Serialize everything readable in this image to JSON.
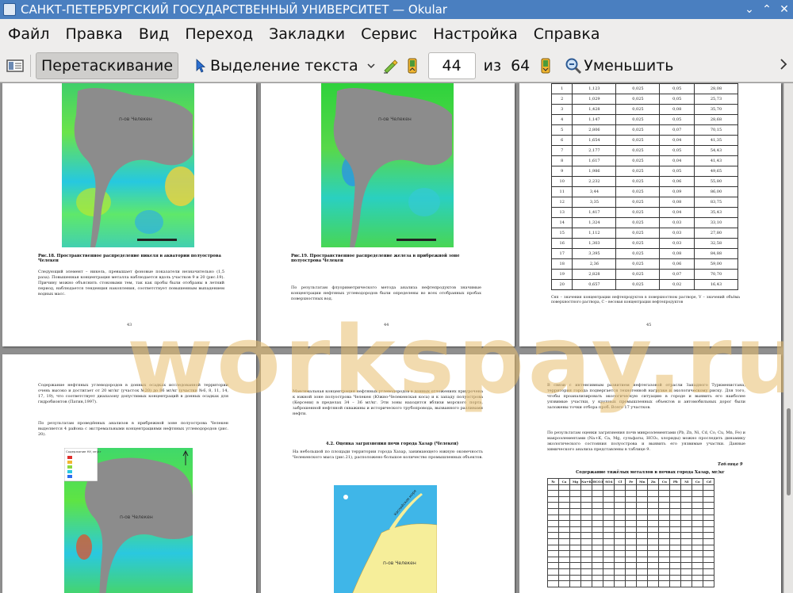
{
  "window": {
    "title": "САНКТ-ПЕТЕРБУРГСКИЙ ГОСУДАРСТВЕННЫЙ УНИВЕРСИТЕТ  — Okular",
    "btn_min": "⌄",
    "btn_max": "⌃",
    "btn_close": "✕"
  },
  "menu": [
    "Файл",
    "Правка",
    "Вид",
    "Переход",
    "Закладки",
    "Сервис",
    "Настройка",
    "Справка"
  ],
  "toolbar": {
    "browse": "Перетаскивание",
    "select_text": "Выделение текста",
    "page_current": "44",
    "page_of": "из",
    "page_total": "64",
    "zoom_out": "Уменьшить"
  },
  "watermark": "workspay.ru",
  "pages": {
    "p43": {
      "map_label": "п-ов Челекен",
      "caption": "Рис.18. Пространственное распределение никеля в акватории полуострова Челекен",
      "text": "Следующий элемент – никель, превышает фоновые показатели незначительно (1,5 раза). Повышенная концентрация металла наблюдается вдоль участков 9 и 20 (рис.19). Причину можно объяснить стоковыми тем, так как пробы были отобраны в летний период, наблюдается тенденция накопления, соответствует повышенным выпадением водных масс.",
      "num": "43"
    },
    "p44": {
      "map_label": "п-ов Челекен",
      "caption": "Рис.19. Пространственное распределение железа в прибрежной зоне полуострова Челекен",
      "text": "По результатам флуориметрического метода анализа нефтепродуктов значимые концентрации нефтяных углеводородов были определены во всех отобранных пробах поверхностных вод.",
      "num": "44"
    },
    "p45": {
      "rows": [
        [
          "1",
          "1,123",
          "0,025",
          "0,05",
          "28,08"
        ],
        [
          "2",
          "1,029",
          "0,025",
          "0,05",
          "25,73"
        ],
        [
          "3",
          "1,428",
          "0,025",
          "0,08",
          "35,70"
        ],
        [
          "4",
          "1,147",
          "0,025",
          "0,05",
          "28,68"
        ],
        [
          "5",
          "2,806",
          "0,025",
          "0,07",
          "70,15"
        ],
        [
          "6",
          "1,654",
          "0,025",
          "0,04",
          "41,35"
        ],
        [
          "7",
          "2,177",
          "0,025",
          "0,05",
          "54,43"
        ],
        [
          "8",
          "1,617",
          "0,025",
          "0,04",
          "41,43"
        ],
        [
          "9",
          "1,986",
          "0,025",
          "0,05",
          "49,65"
        ],
        [
          "10",
          "2,232",
          "0,025",
          "0,06",
          "55,80"
        ],
        [
          "11",
          "3,44",
          "0,025",
          "0,09",
          "86,00"
        ],
        [
          "12",
          "3,35",
          "0,025",
          "0,08",
          "83,75"
        ],
        [
          "13",
          "1,417",
          "0,025",
          "0,04",
          "35,43"
        ],
        [
          "14",
          "1,324",
          "0,025",
          "0,03",
          "33,10"
        ],
        [
          "15",
          "1,112",
          "0,025",
          "0,03",
          "27,80"
        ],
        [
          "16",
          "1,303",
          "0,025",
          "0,03",
          "32,58"
        ],
        [
          "17",
          "3,395",
          "0,025",
          "0,08",
          "84,88"
        ],
        [
          "18",
          "2,36",
          "0,025",
          "0,06",
          "59,00"
        ],
        [
          "19",
          "2,828",
          "0,025",
          "0,07",
          "70,70"
        ],
        [
          "20",
          "0,657",
          "0,025",
          "0,02",
          "16,43"
        ]
      ],
      "note": "Cнп – значения концентрации нефтепродуктов в поверхностном растворе, V – значений объёма поверхностного раствора, С – весовая концентрация нефтепродуктов",
      "num": "45"
    },
    "p46": {
      "text1": "Содержание нефтяных углеводородов в донных осадках исследованной территории очень высоко и достигает от 20 мг/кг (участок №20) до 86 мг/кг (участки №6, 8, 11, 14, 17, 19), что соответствует диапазону допустимых концентраций в донных осадках для гидробионтов (Патин,1997).",
      "text2": "По результатам проведённых анализов в прибрежной зоне полуострова Челекен выделяется 4 района с экстремальными концентрациями нефтяных углеводородов (рис. 20).",
      "legend_title": "Содержание НУ, мг/кг",
      "map_label": "п-ов Челекен"
    },
    "p47": {
      "text1": "Максимальная концентрация нефтяных углеводородов в донных отложениях приурочена к южной зоне полуострова Челекен (Южно-Челекенская коса) и к западу полуострова (Керсени) в пределах 34 – 36 мг/кг. Эти зоны находятся вблизи морского порта, заброшенной нефтяной скважины и исторического трубопровода, вызванного разливами нефти.",
      "heading": "4.2. Оценка загрязнения почв города Хазар (Челекен)",
      "text2": "На небольшой по площади территории города Хазар, занимающего южную оконечность Челекенского мыса (рис.21), расположено большое количество промышленных объектов.",
      "map_label": "п-ов Челекен",
      "sea_label": "Каспийское море"
    },
    "p48": {
      "text1": "В связи с интенсивным развитием нефтегазовой отрасли Западного Туркменистана, территория города подвергается техногенной нагрузке и экологическому риску. Для того, чтобы проанализировать экологическую ситуацию в городе и выявить его наиболее уязвимые участки, у крупных промышленных объектов и автомобильных дорог были заложены точки отбора проб. Всего 17 участков.",
      "text2": "По результатам оценки загрязнения почв микроэлементами (Pb, Zn, Ni, Cd, Co, Cu, Mn, Fe) и макроэлементами (Na+K, Ca, Mg, сульфаты, HCO₃, хлориды) можно проследить динамику экологического состояния полуострова и выявить его уязвимые участки. Данные химического анализа представлены в таблице 9.",
      "table_label": "Таблица 9",
      "table_title": "Содержание тяжёлых металлов в почвах города Хазар, мг/кг",
      "headers": [
        "№",
        "Ca",
        "Mg",
        "Na+K",
        "HCO3",
        "SO4",
        "Cl",
        "Fe",
        "Mn",
        "Zn",
        "Cu",
        "Pb",
        "Ni",
        "Co",
        "Cd"
      ]
    }
  }
}
